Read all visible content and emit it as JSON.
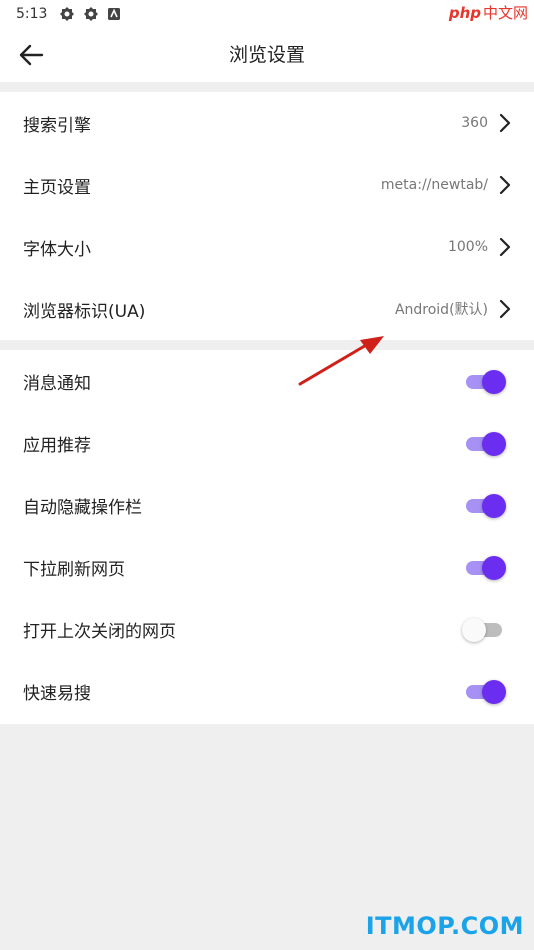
{
  "status_bar": {
    "time": "5:13",
    "icons": [
      "settings-icon",
      "settings-icon",
      "notification-icon"
    ]
  },
  "watermark_top": {
    "brand": "php",
    "suffix": "中文网"
  },
  "app_bar": {
    "title": "浏览设置",
    "back_icon": "arrow-left-icon"
  },
  "section1": {
    "rows": [
      {
        "label": "搜索引擎",
        "value": "360"
      },
      {
        "label": "主页设置",
        "value": "meta://newtab/"
      },
      {
        "label": "字体大小",
        "value": "100%"
      },
      {
        "label": "浏览器标识(UA)",
        "value": "Android(默认)"
      }
    ]
  },
  "section2": {
    "rows": [
      {
        "label": "消息通知",
        "enabled": true
      },
      {
        "label": "应用推荐",
        "enabled": true
      },
      {
        "label": "自动隐藏操作栏",
        "enabled": true
      },
      {
        "label": "下拉刷新网页",
        "enabled": true
      },
      {
        "label": "打开上次关闭的网页",
        "enabled": false
      },
      {
        "label": "快速易搜",
        "enabled": true
      }
    ]
  },
  "colors": {
    "accent": "#6b2df0",
    "accent_track": "#a791f5",
    "annotation_arrow": "#d0201a",
    "watermark_bottom": "#1aa3e8"
  },
  "watermark_bottom": "ITMOP.COM"
}
